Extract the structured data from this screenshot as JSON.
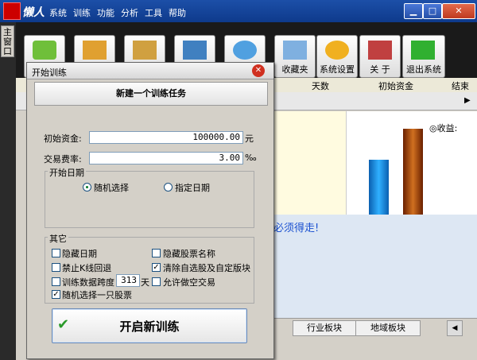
{
  "app": {
    "name": "懒人",
    "menu": [
      "系统",
      "训练",
      "功能",
      "分析",
      "工具",
      "帮助"
    ]
  },
  "left_tab": "主窗口",
  "toolbar": {
    "buttons": [
      {
        "label": "收藏夹",
        "icon": "favorites-icon"
      },
      {
        "label": "系统设置",
        "icon": "gear-icon"
      },
      {
        "label": "关 于",
        "icon": "about-icon"
      },
      {
        "label": "退出系统",
        "icon": "exit-arrow-icon"
      }
    ]
  },
  "grid": {
    "headers": [
      "天数",
      "初始资金",
      "结束"
    ]
  },
  "chart": {
    "label": "◎收益:",
    "footer_text": "必须得走!"
  },
  "dialog": {
    "title": "开始训练",
    "header_button": "新建一个训练任务",
    "initial_funds_label": "初始资金:",
    "initial_funds_value": "100000.00",
    "initial_funds_unit": "元",
    "fee_label": "交易费率:",
    "fee_value": "3.00",
    "fee_unit": "‰",
    "start_date": {
      "title": "开始日期",
      "option_random": "随机选择",
      "option_specified": "指定日期"
    },
    "other": {
      "title": "其它",
      "hide_date": "隐藏日期",
      "hide_stock_name": "隐藏股票名称",
      "forbid_rollback": "禁止K线回退",
      "clear_watchlist": "清除自选股及自定版块",
      "span_label": "训练数据跨度",
      "span_value": "313",
      "span_unit": "天",
      "allow_short": "允许做空交易",
      "random_one": "随机选择一只股票"
    },
    "start_button": "开启新训练"
  },
  "bottom_tabs": [
    "行业板块",
    "地域板块"
  ],
  "colors": {
    "titlebar": "#1c4fa8",
    "bar_blue": "#1e90e0",
    "bar_red": "#a63a00"
  }
}
